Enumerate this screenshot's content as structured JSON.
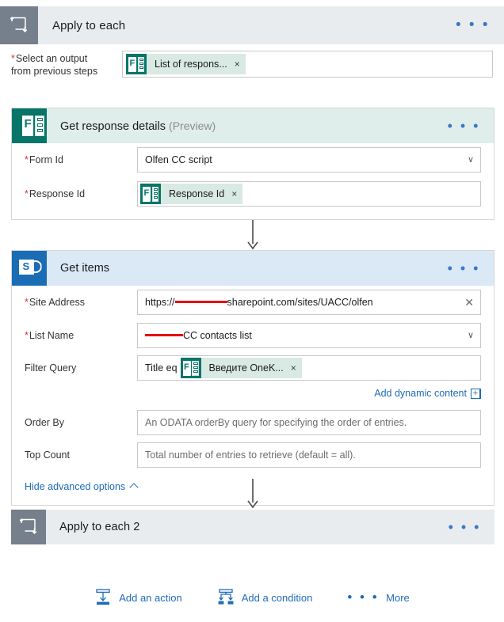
{
  "scope": {
    "icon": "loop-icon",
    "title": "Apply to each",
    "menu": "• • •",
    "field": {
      "label_line1": "Select an output",
      "label_line2": "from previous steps",
      "required": "*",
      "token": {
        "icon": "microsoft-forms-icon",
        "label": "List of respons...",
        "remove": "×"
      }
    }
  },
  "cards": [
    {
      "id": "get-response-details",
      "icon": "microsoft-forms-icon",
      "title": "Get response details",
      "title_suffix": "(Preview)",
      "menu": "• • •",
      "fields": [
        {
          "name": "form-id",
          "label": "Form Id",
          "required": "*",
          "type": "dropdown",
          "value": "Olfen CC script",
          "caret": "∨"
        },
        {
          "name": "response-id",
          "label": "Response Id",
          "required": "*",
          "type": "token",
          "token": {
            "icon": "microsoft-forms-icon",
            "label": "Response Id",
            "remove": "×"
          }
        }
      ]
    },
    {
      "id": "get-items",
      "icon": "sharepoint-icon",
      "title": "Get items",
      "title_suffix": "",
      "menu": "• • •",
      "fields": [
        {
          "name": "site-address",
          "label": "Site Address",
          "required": "*",
          "type": "text-clear",
          "value_prefix": "https://",
          "value_redacted": true,
          "value_suffix": "sharepoint.com/sites/UACC/olfen",
          "clear": "✕"
        },
        {
          "name": "list-name",
          "label": "List Name",
          "required": "*",
          "type": "dropdown",
          "value_prefix": "",
          "value_redacted": true,
          "value_suffix": "CC contacts list",
          "caret": "∨"
        },
        {
          "name": "filter-query",
          "label": "Filter Query",
          "required": "",
          "type": "text-with-token",
          "value_prefix": "Title eq",
          "token": {
            "icon": "microsoft-forms-icon",
            "label": "Введите OneK...",
            "remove": "×"
          }
        },
        {
          "name": "order-by",
          "label": "Order By",
          "required": "",
          "type": "placeholder",
          "placeholder": "An ODATA orderBy query for specifying the order of entries."
        },
        {
          "name": "top-count",
          "label": "Top Count",
          "required": "",
          "type": "placeholder",
          "placeholder": "Total number of entries to retrieve (default = all)."
        }
      ],
      "dynamic_content_link": "Add dynamic content",
      "dynamic_content_plus": "+",
      "advanced_link": "Hide advanced options"
    }
  ],
  "scope2": {
    "icon": "loop-icon",
    "title": "Apply to each 2",
    "menu": "• • •"
  },
  "actionbar": [
    {
      "name": "add-an-action",
      "icon": "add-action-icon",
      "label": "Add an action"
    },
    {
      "name": "add-a-condition",
      "icon": "add-condition-icon",
      "label": "Add a condition"
    },
    {
      "name": "more",
      "icon": "ellipsis-icon",
      "label": "More",
      "dots": "• • •"
    }
  ],
  "colors": {
    "scope_header_bg": "#e8ecef",
    "scope_icon_bg": "#76808c",
    "forms_header_bg": "#dfeeea",
    "forms_icon_bg": "#077568",
    "sharepoint_header_bg": "#dbe8f6",
    "sharepoint_icon_bg": "#1a6cb5",
    "token_chip_bg": "#d9e9e3",
    "link_blue": "#1f6bb8",
    "required_red": "#d13438",
    "redaction_red": "#e8000d"
  }
}
